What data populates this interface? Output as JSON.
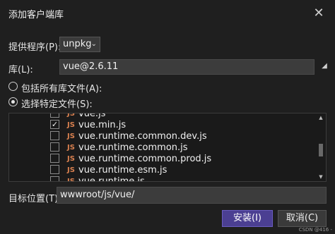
{
  "dialog": {
    "title": "添加客户端库"
  },
  "provider": {
    "label": "提供程序(P):",
    "value": "unpkg"
  },
  "library": {
    "label": "库(L):",
    "value": "vue@2.6.11"
  },
  "files_option": {
    "all_label": "包括所有库文件(A):",
    "specific_label": "选择特定文件(S):",
    "selected": "specific"
  },
  "file_list": [
    {
      "name": "vue.js",
      "checked": false
    },
    {
      "name": "vue.min.js",
      "checked": true
    },
    {
      "name": "vue.runtime.common.dev.js",
      "checked": false
    },
    {
      "name": "vue.runtime.common.js",
      "checked": false
    },
    {
      "name": "vue.runtime.common.prod.js",
      "checked": false
    },
    {
      "name": "vue.runtime.esm.js",
      "checked": false
    },
    {
      "name": "vue.runtime.js",
      "checked": false
    }
  ],
  "file_badge": "JS",
  "target": {
    "label": "目标位置(T):",
    "value": "wwwroot/js/vue/"
  },
  "buttons": {
    "install": "安装(I)",
    "cancel": "取消(C)"
  },
  "watermark": "CSDN @416 -",
  "colors": {
    "accent": "#4b3f92",
    "js_badge": "#d9804f"
  }
}
